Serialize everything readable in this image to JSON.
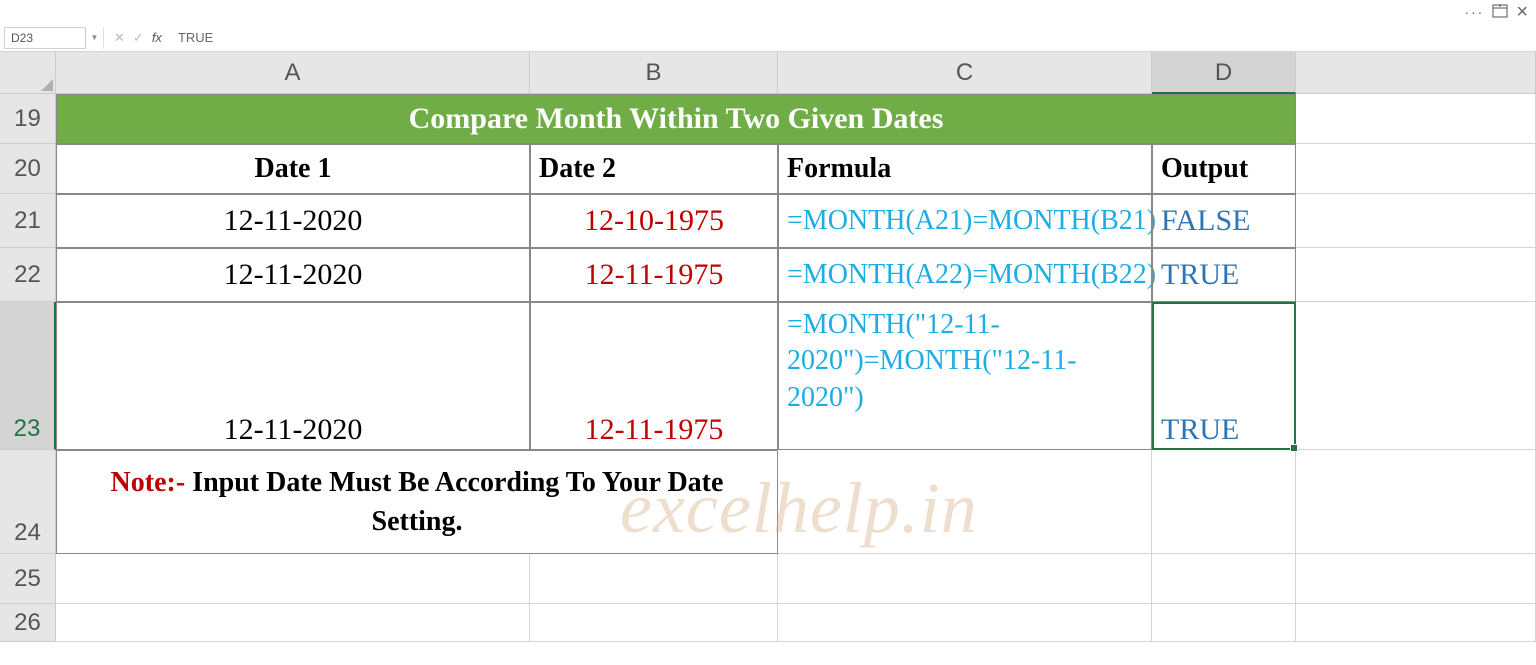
{
  "titleBar": {
    "dots": "···"
  },
  "nameBox": {
    "value": "D23"
  },
  "formulaBar": {
    "value": "TRUE"
  },
  "columns": {
    "A": "A",
    "B": "B",
    "C": "C",
    "D": "D"
  },
  "rows": {
    "r19": "19",
    "r20": "20",
    "r21": "21",
    "r22": "22",
    "r23": "23",
    "r24": "24",
    "r25": "25",
    "r26": "26"
  },
  "sheet": {
    "title": "Compare Month Within Two Given Dates",
    "headers": {
      "date1": "Date 1",
      "date2": "Date 2",
      "formula": "Formula",
      "output": "Output"
    },
    "row21": {
      "date1": "12-11-2020",
      "date2": "12-10-1975",
      "formula": "=MONTH(A21)=MONTH(B21)",
      "output": "FALSE"
    },
    "row22": {
      "date1": "12-11-2020",
      "date2": "12-11-1975",
      "formula": "=MONTH(A22)=MONTH(B22)",
      "output": "TRUE"
    },
    "row23": {
      "date1": "12-11-2020",
      "date2": "12-11-1975",
      "formula": "=MONTH(\"12-11-2020\")=MONTH(\"12-11-2020\")",
      "output": "TRUE"
    },
    "note": {
      "label": "Note:-",
      "text": " Input Date Must Be According To Your Date Setting."
    }
  },
  "watermark": "excelhelp.in"
}
